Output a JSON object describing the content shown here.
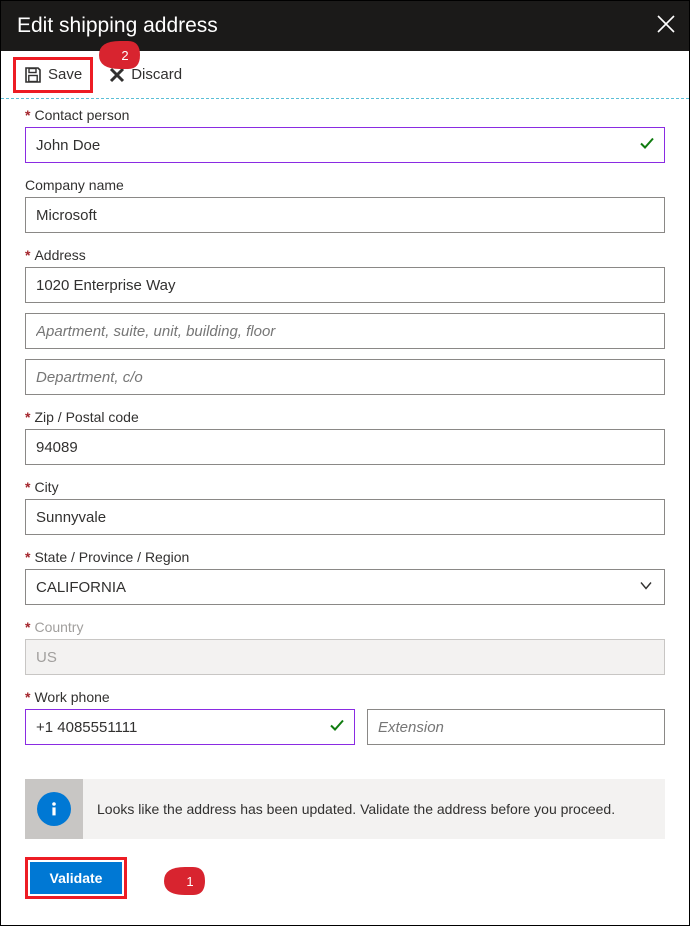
{
  "header": {
    "title": "Edit shipping address"
  },
  "toolbar": {
    "save_label": "Save",
    "discard_label": "Discard"
  },
  "callouts": {
    "one": "1",
    "two": "2"
  },
  "fields": {
    "contact_person": {
      "label": "Contact person",
      "value": "John Doe",
      "required": true
    },
    "company_name": {
      "label": "Company name",
      "value": "Microsoft",
      "required": false
    },
    "address": {
      "label": "Address",
      "value": "1020 Enterprise Way",
      "required": true
    },
    "address2": {
      "placeholder": "Apartment, suite, unit, building, floor"
    },
    "address3": {
      "placeholder": "Department, c/o"
    },
    "zip": {
      "label": "Zip / Postal code",
      "value": "94089",
      "required": true
    },
    "city": {
      "label": "City",
      "value": "Sunnyvale",
      "required": true
    },
    "state": {
      "label": "State / Province / Region",
      "value": "CALIFORNIA",
      "required": true
    },
    "country": {
      "label": "Country",
      "value": "US",
      "required": true
    },
    "work_phone": {
      "label": "Work phone",
      "value": "+1 4085551111",
      "required": true
    },
    "extension": {
      "placeholder": "Extension"
    }
  },
  "info": {
    "message": "Looks like the address has been updated. Validate the address before you proceed."
  },
  "actions": {
    "validate_label": "Validate"
  }
}
